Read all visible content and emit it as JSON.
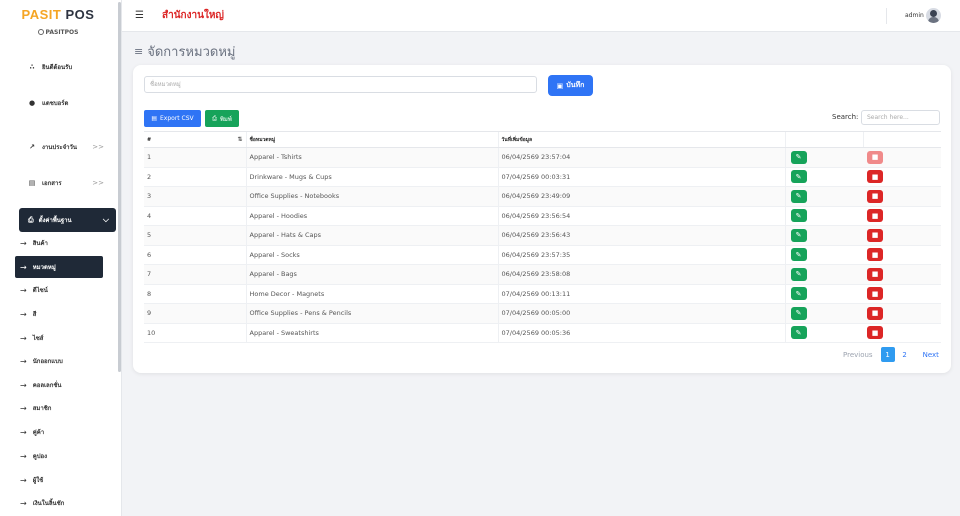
{
  "brand": {
    "name_part1": "PASIT",
    "name_part2": "POS",
    "subtitle": "PASITPOS"
  },
  "topbar": {
    "menu_icon": "hamburger-icon",
    "branch": "สำนักงานใหญ่",
    "user": "admin"
  },
  "sidebar": {
    "items": [
      {
        "label": "ยินดีต้อนรับ",
        "icon": "sitemap-icon"
      },
      {
        "label": "แดชบอร์ด",
        "icon": "info-circle-icon"
      },
      {
        "label": "งานประจำวัน",
        "icon": "trend-icon",
        "expand": ">>"
      },
      {
        "label": "เอกสาร",
        "icon": "document-icon",
        "expand": ">>"
      }
    ],
    "active_group": {
      "label": "ตั้งค่าพื้นฐาน",
      "icon": "printer-icon"
    },
    "sub_items": [
      "สินค้า",
      "หมวดหมู่",
      "ดีไซน์",
      "สี",
      "ไซส์",
      "นักออกแบบ",
      "คอลเลกชั่น",
      "สมาชิก",
      "คู่ค้า",
      "คูปอง",
      "ผู้ใช้",
      "เงินในลิ้นชัก"
    ],
    "active_sub_index": 1
  },
  "page": {
    "title": "จัดการหมวดหมู่"
  },
  "form": {
    "name_placeholder": "ชื่อหมวดหมู่",
    "save_label": "บันทึก"
  },
  "toolbar": {
    "csv_label": "Export CSV",
    "print_label": "พิมพ์"
  },
  "search": {
    "label": "Search:",
    "placeholder": "Search here..."
  },
  "table": {
    "headers": [
      "#",
      "ชื่อหมวดหมู่",
      "วันที่เพิ่มข้อมูล",
      "",
      ""
    ],
    "rows": [
      {
        "no": "1",
        "name": "Apparel - Tshirts",
        "date": "06/04/2569 23:57:04"
      },
      {
        "no": "2",
        "name": "Drinkware - Mugs & Cups",
        "date": "07/04/2569 00:03:31"
      },
      {
        "no": "3",
        "name": "Office Supplies - Notebooks",
        "date": "06/04/2569 23:49:09"
      },
      {
        "no": "4",
        "name": "Apparel - Hoodies",
        "date": "06/04/2569 23:56:54"
      },
      {
        "no": "5",
        "name": "Apparel - Hats & Caps",
        "date": "06/04/2569 23:56:43"
      },
      {
        "no": "6",
        "name": "Apparel - Socks",
        "date": "06/04/2569 23:57:35"
      },
      {
        "no": "7",
        "name": "Apparel - Bags",
        "date": "06/04/2569 23:58:08"
      },
      {
        "no": "8",
        "name": "Home Decor - Magnets",
        "date": "07/04/2569 00:13:11"
      },
      {
        "no": "9",
        "name": "Office Supplies - Pens & Pencils",
        "date": "07/04/2569 00:05:00"
      },
      {
        "no": "10",
        "name": "Apparel - Sweatshirts",
        "date": "07/04/2569 00:05:36"
      }
    ]
  },
  "pagination": {
    "prev": "Previous",
    "pages": [
      "1",
      "2"
    ],
    "current": "1",
    "next": "Next"
  },
  "colors": {
    "primary": "#2f74f5",
    "success": "#16a35a",
    "danger": "#dc2626",
    "dark": "#1f2937",
    "brand": "#f5a524"
  }
}
